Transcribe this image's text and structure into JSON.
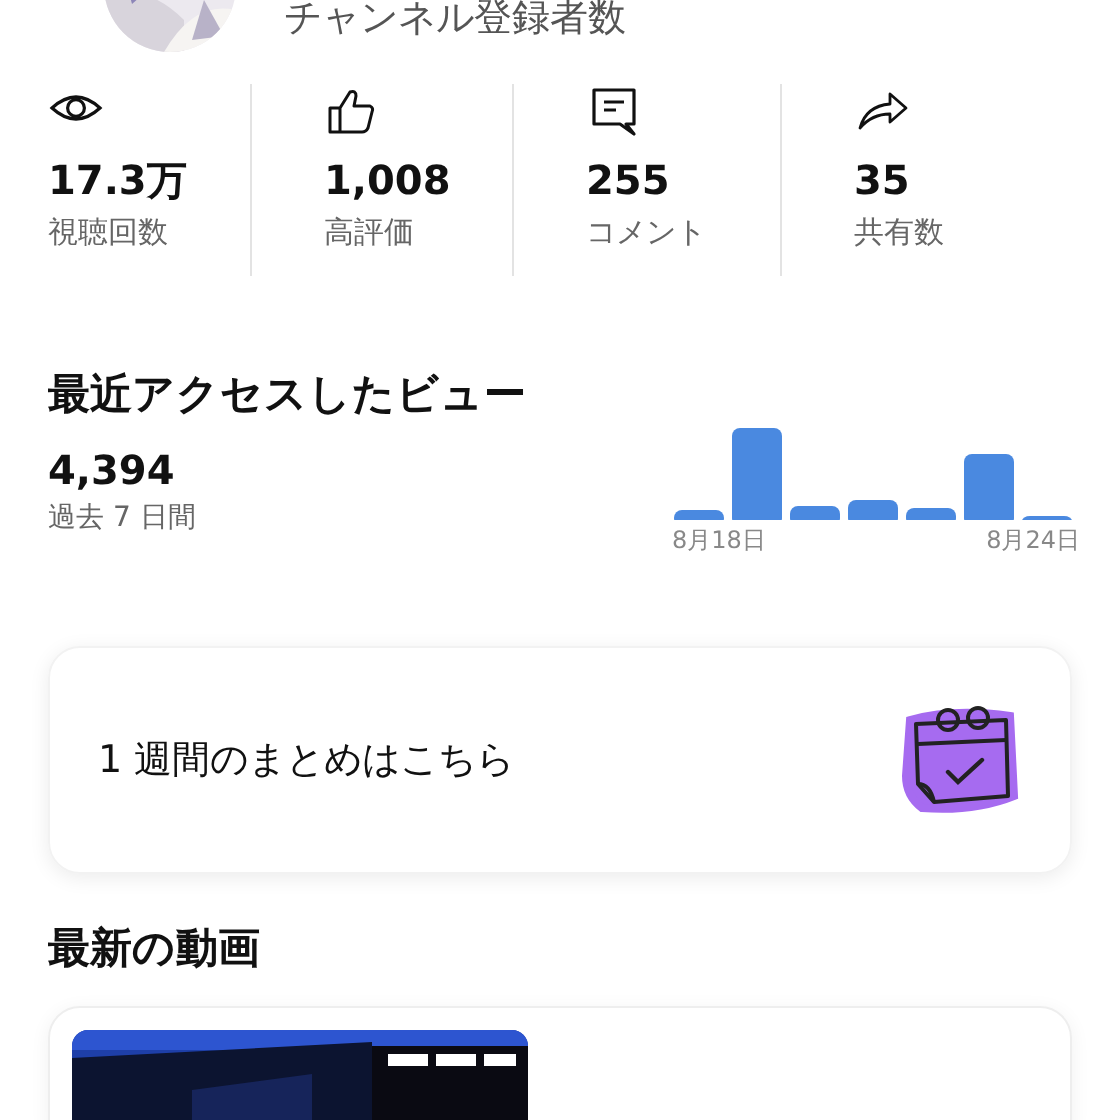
{
  "channel": {
    "subscribers_label": "チャンネル登録者数"
  },
  "stats": [
    {
      "kind": "views",
      "value": "17.3万",
      "label": "視聴回数"
    },
    {
      "kind": "likes",
      "value": "1,008",
      "label": "高評価"
    },
    {
      "kind": "comments",
      "value": "255",
      "label": "コメント"
    },
    {
      "kind": "shares",
      "value": "35",
      "label": "共有数"
    }
  ],
  "recent_views": {
    "title": "最近アクセスしたビュー",
    "total": "4,394",
    "period": "過去 7 日間",
    "date_labels": [
      "8月18日",
      "8月24日"
    ]
  },
  "summary_card": {
    "label": "1 週間のまとめはこちら"
  },
  "latest_videos": {
    "title": "最新の動画"
  }
}
